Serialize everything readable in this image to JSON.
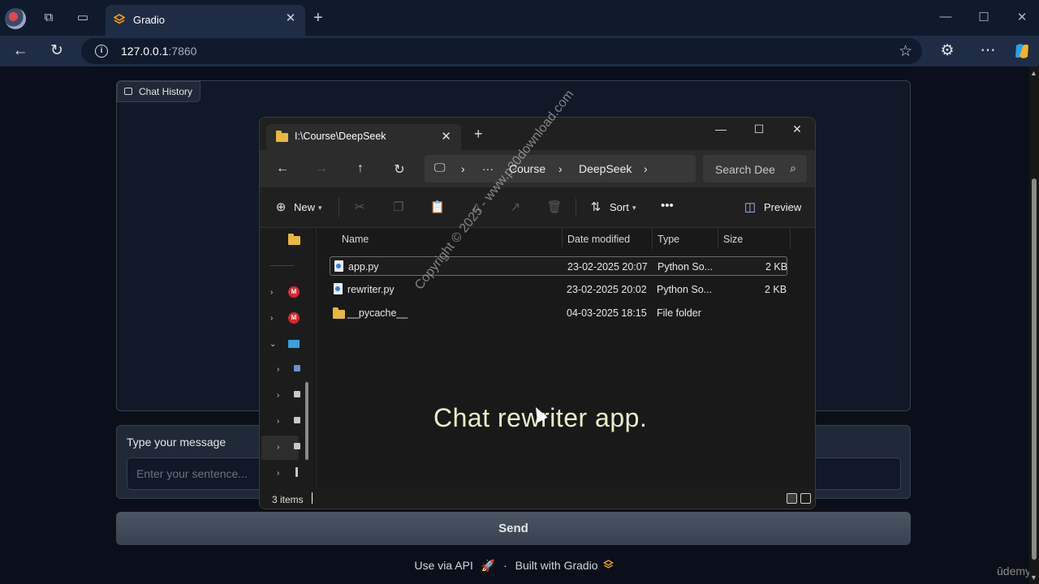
{
  "browser": {
    "tab_title": "Gradio",
    "url_host": "127.0.0.1",
    "url_port": ":7860",
    "icons": [
      "profile-icon",
      "workspaces-icon",
      "tab-actions-icon",
      "gradio-logo-icon",
      "close-icon",
      "new-tab-icon",
      "minimize-icon",
      "maximize-icon",
      "close-window-icon",
      "back-icon",
      "refresh-icon",
      "info-icon",
      "favorite-star-icon",
      "extensions-icon",
      "more-icon",
      "copilot-icon"
    ]
  },
  "app": {
    "chat_label": "Chat History",
    "message_label": "Type your message",
    "message_placeholder": "Enter your sentence...",
    "message_value": "",
    "send_label": "Send",
    "footer_api": "Use via API",
    "footer_dot": "·",
    "footer_built": "Built with Gradio",
    "colors": {
      "page_bg": "#0b0f19",
      "panel_bg": "#1f2937",
      "border": "#374151"
    }
  },
  "explorer": {
    "tab_title": "I:\\Course\\DeepSeek",
    "breadcrumb": [
      "Course",
      "DeepSeek"
    ],
    "breadcrumb_more": "···",
    "search_placeholder": "Search Dee",
    "commands": {
      "new": "New",
      "sort": "Sort",
      "more": "•••",
      "preview": "Preview"
    },
    "columns": [
      "Name",
      "Date modified",
      "Type",
      "Size"
    ],
    "files": [
      {
        "name": "app.py",
        "date": "23-02-2025 20:07",
        "type": "Python So...",
        "size": "2 KB",
        "icon": "python-file-icon",
        "selected": true
      },
      {
        "name": "rewriter.py",
        "date": "23-02-2025 20:02",
        "type": "Python So...",
        "size": "2 KB",
        "icon": "python-file-icon",
        "selected": false
      },
      {
        "name": "__pycache__",
        "date": "04-03-2025 18:15",
        "type": "File folder",
        "size": "",
        "icon": "folder-icon",
        "selected": false
      }
    ],
    "status": "3 items",
    "sidebar_badges": [
      "M",
      "M"
    ]
  },
  "overlay": {
    "caption": "Chat rewriter app.",
    "watermark": "Copyright © 2025 - www.p30download.com",
    "brand": "ûdemy"
  }
}
